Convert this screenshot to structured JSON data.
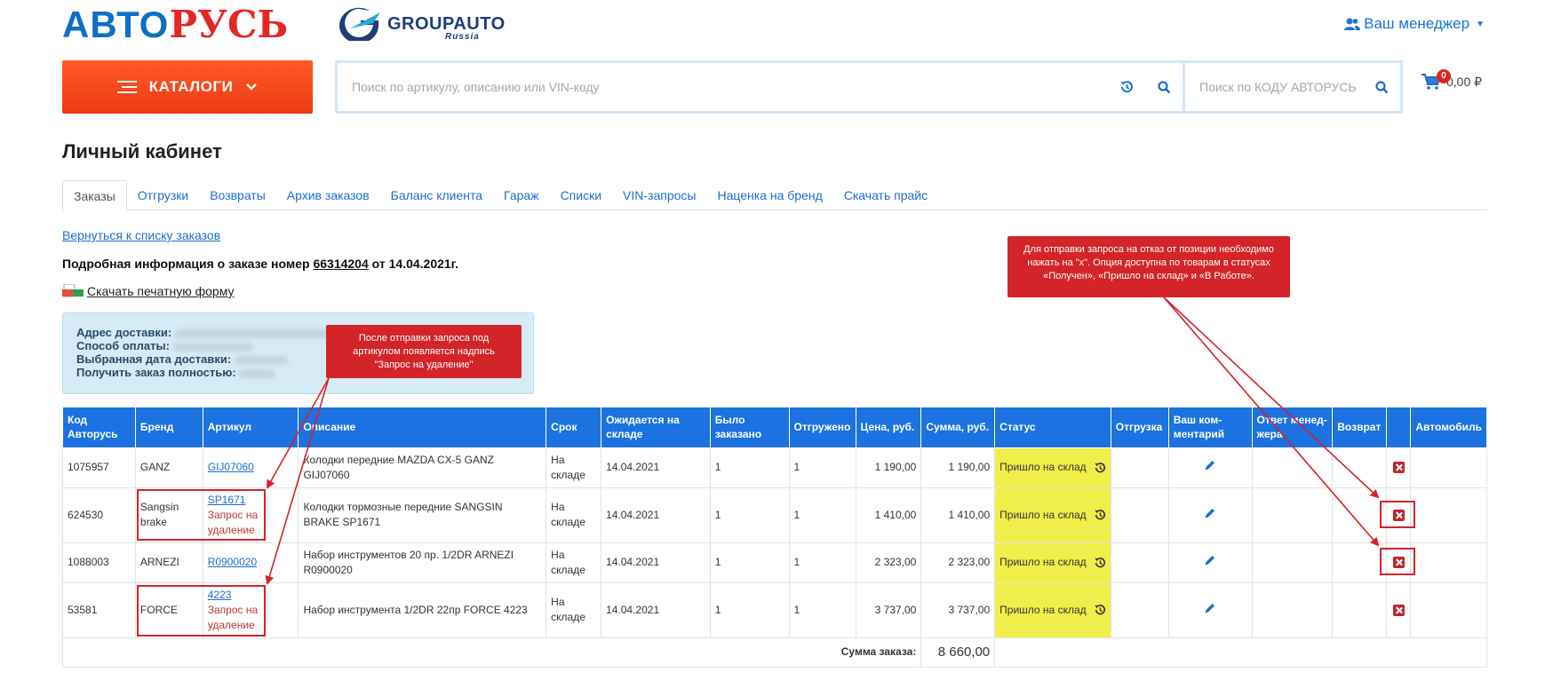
{
  "header": {
    "logo_prefix": "АВТО",
    "logo_suffix": "РУСЬ",
    "partner_name": "GROUPAUTO",
    "partner_sub": "Russia",
    "manager_label": "Ваш менеджер"
  },
  "toolbar": {
    "catalog_label": "КАТАЛОГИ",
    "search_placeholder": "Поиск по артикулу, описанию или VIN-коду",
    "code_search_placeholder": "Поиск по КОДУ АВТОРУСЬ",
    "cart_count": "0",
    "cart_total": "0,00 ₽"
  },
  "page": {
    "title": "Личный кабинет",
    "tabs": [
      "Заказы",
      "Отгрузки",
      "Возвраты",
      "Архив заказов",
      "Баланс клиента",
      "Гараж",
      "Списки",
      "VIN-запросы",
      "Наценка на бренд",
      "Скачать прайс"
    ],
    "back_link": "Вернуться к списку заказов",
    "order_prefix": "Подробная информация о заказе номер",
    "order_number": "66314204",
    "order_suffix": "от 14.04.2021г.",
    "print_link": "Скачать печатную форму",
    "pdf_badge": "PDF XLS"
  },
  "info": {
    "address_label": "Адрес доставки:",
    "payment_label": "Способ оплаты:",
    "date_label": "Выбранная дата доставки:",
    "full_label": "Получить заказ полностью:"
  },
  "callouts": {
    "left": "После отправки запроса под артикулом появляется надпись \"Запрос на удаление\"",
    "right": "Для отправки запроса на отказ от позиции необходимо нажать на \"x\". Опция доступна по товарам в статусах «Получен», «Пришло на склад» и «В Работе»."
  },
  "table": {
    "headers": [
      "Код Авторусь",
      "Бренд",
      "Артикул",
      "Описание",
      "Срок",
      "Ожидается на складе",
      "Было заказано",
      "Отгружено",
      "Цена, руб.",
      "Сумма, руб.",
      "Статус",
      "Отгрузка",
      "Ваш ком-ментарий",
      "Ответ менед-жера",
      "Возврат",
      "",
      "Автомобиль"
    ],
    "rows": [
      {
        "code": "1075957",
        "brand": "GANZ",
        "article": "GIJ07060",
        "request": "",
        "desc": "Колодки передние MAZDA CX-5 GANZ GIJ07060",
        "term": "На складе",
        "expected": "14.04.2021",
        "ordered": "1",
        "shipped": "1",
        "price": "1 190,00",
        "sum": "1 190,00",
        "status": "Пришло на склад"
      },
      {
        "code": "624530",
        "brand": "Sangsin brake",
        "article": "SP1671",
        "request": "Запрос на удаление",
        "desc": "Колодки тормозные передние SANGSIN BRAKE SP1671",
        "term": "На складе",
        "expected": "14.04.2021",
        "ordered": "1",
        "shipped": "1",
        "price": "1 410,00",
        "sum": "1 410,00",
        "status": "Пришло на склад"
      },
      {
        "code": "1088003",
        "brand": "ARNEZI",
        "article": "R0900020",
        "request": "",
        "desc": "Набор инструментов 20 пр. 1/2DR ARNEZI R0900020",
        "term": "На складе",
        "expected": "14.04.2021",
        "ordered": "1",
        "shipped": "1",
        "price": "2 323,00",
        "sum": "2 323,00",
        "status": "Пришло на склад"
      },
      {
        "code": "53581",
        "brand": "FORCE",
        "article": "4223",
        "request": "Запрос на удаление",
        "desc": "Набор инструмента 1/2DR 22пр FORCE 4223",
        "term": "На складе",
        "expected": "14.04.2021",
        "ordered": "1",
        "shipped": "1",
        "price": "3 737,00",
        "sum": "3 737,00",
        "status": "Пришло на склад"
      }
    ],
    "total_label": "Сумма заказа:",
    "total_value": "8 660,00"
  },
  "colors": {
    "accent_blue": "#1b72e0",
    "catalog_orange": "#ee3a17",
    "status_yellow": "#f0ee4a",
    "callout_red": "#d3242a"
  },
  "icons": [
    "user-icon",
    "menu-icon",
    "chevron-down-icon",
    "history-icon",
    "search-icon",
    "cart-icon",
    "pdf-icon",
    "pencil-icon",
    "delete-icon"
  ]
}
